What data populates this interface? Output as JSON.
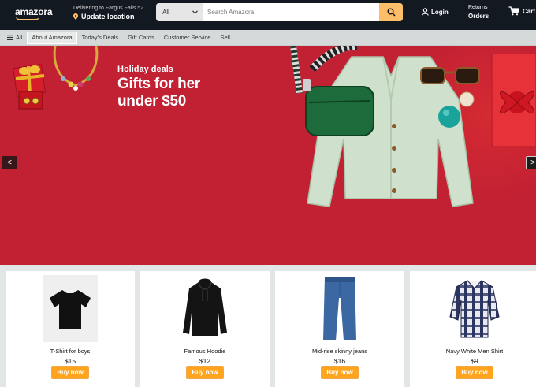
{
  "header": {
    "logo": "amazora",
    "delivery_line1": "Delivering to Fargus Falls 52",
    "delivery_line2": "Update location",
    "search_category": "All",
    "search_placeholder": "Search Amazora",
    "login_label": "Login",
    "returns_line1": "Returns",
    "returns_line2": "Orders",
    "cart_label": "Cart"
  },
  "subnav": {
    "all_label": "All",
    "items": [
      "About Amazora",
      "Today's Deals",
      "Gift Cards",
      "Customer Service",
      "Sell"
    ]
  },
  "hero": {
    "subtitle": "Holiday deals",
    "title": "Gifts for her under $50",
    "prev": "<",
    "next": ">"
  },
  "products": [
    {
      "name": "T-Shirt for boys",
      "price": "$15",
      "button": "Buy now",
      "icon": "tshirt-image"
    },
    {
      "name": "Famous Hoodie",
      "price": "$12",
      "button": "Buy now",
      "icon": "hoodie-image"
    },
    {
      "name": "Mid-rise skinny jeans",
      "price": "$16",
      "button": "Buy now",
      "icon": "jeans-image"
    },
    {
      "name": "Navy White Men Shirt",
      "price": "$9",
      "button": "Buy now",
      "icon": "plaid-shirt-image"
    }
  ],
  "colors": {
    "header_bg": "#131921",
    "hero_bg": "#c22133",
    "accent": "#febd69",
    "buy_button": "#ffa41c"
  }
}
